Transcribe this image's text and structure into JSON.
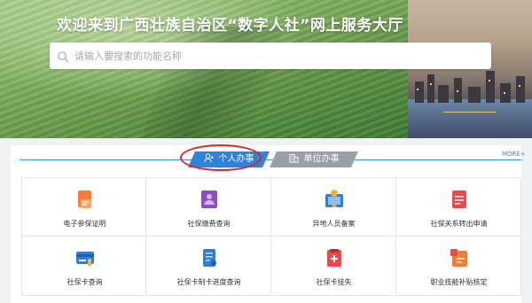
{
  "banner": {
    "title": "欢迎来到广西壮族自治区“数字人社”网上服务大厅"
  },
  "search": {
    "placeholder": "请输入要搜索的功能名称"
  },
  "tabs": {
    "personal_label": "个人办事",
    "unit_label": "单位办事",
    "active": "个人办事"
  },
  "more_label": "MORE+",
  "services": [
    {
      "label": "电子参保证明",
      "icon": "certificate-icon",
      "color": "#f47c38"
    },
    {
      "label": "社保缴费查询",
      "icon": "payment-query-icon",
      "color": "#8a4fc0"
    },
    {
      "label": "异地人员备案",
      "icon": "relocation-record-icon",
      "color": "#2f7fd9"
    },
    {
      "label": "社保关系转出申请",
      "icon": "transfer-application-icon",
      "color": "#e84b4b"
    },
    {
      "label": "社保卡查询",
      "icon": "card-query-icon",
      "color": "#2f7fd9"
    },
    {
      "label": "社保卡制卡进度查询",
      "icon": "card-progress-icon",
      "color": "#2f7fd9"
    },
    {
      "label": "社保卡挂失",
      "icon": "card-loss-report-icon",
      "color": "#e84b4b"
    },
    {
      "label": "职业技能补贴核定",
      "icon": "skill-subsidy-icon",
      "color": "#f47c38"
    }
  ],
  "colors": {
    "accent": "#2f82d8",
    "inactive_tab": "#9a9ea6",
    "highlight_ring": "#d9262c"
  }
}
